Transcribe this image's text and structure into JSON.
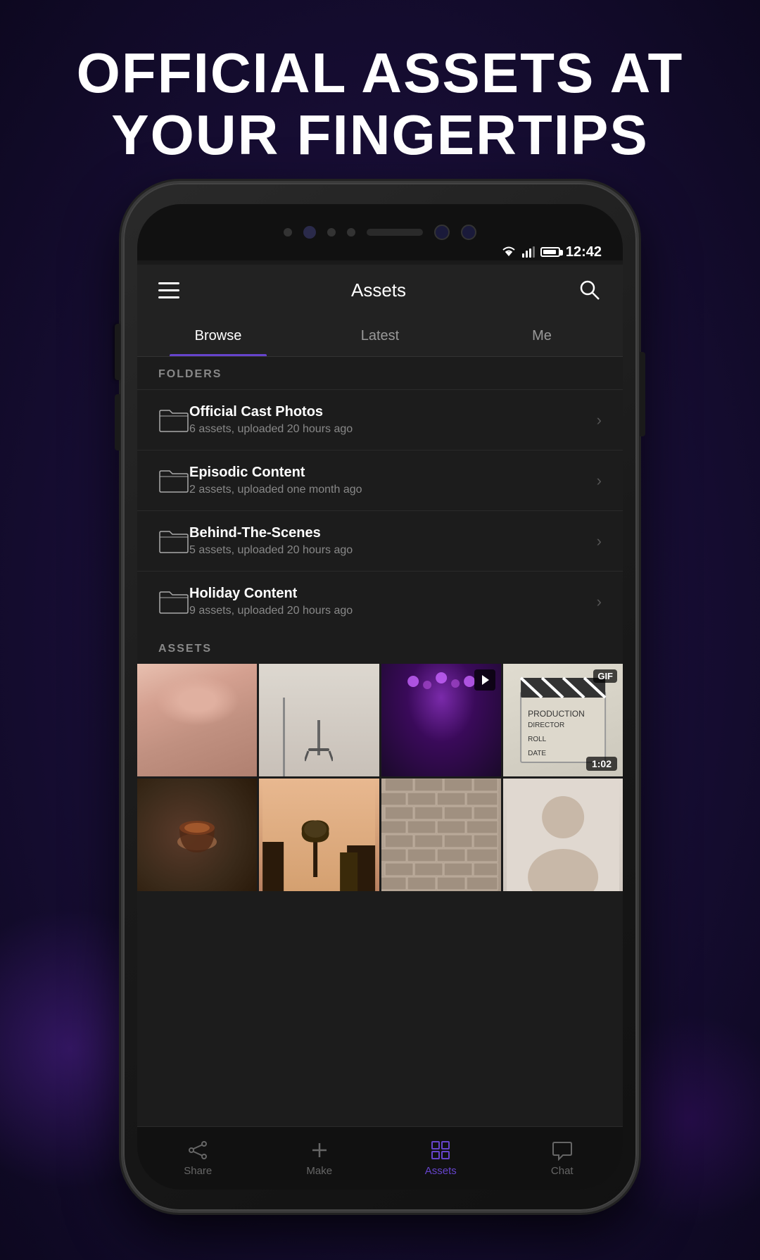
{
  "headline": {
    "line1": "OFFICIAL ASSETS AT",
    "line2": "YOUR FINGERTIPS"
  },
  "status_bar": {
    "time": "12:42"
  },
  "app_header": {
    "title": "Assets",
    "menu_label": "Menu",
    "search_label": "Search"
  },
  "tabs": [
    {
      "id": "browse",
      "label": "Browse",
      "active": true
    },
    {
      "id": "latest",
      "label": "Latest",
      "active": false
    },
    {
      "id": "me",
      "label": "Me",
      "active": false
    }
  ],
  "folders_section": {
    "title": "FOLDERS",
    "items": [
      {
        "name": "Official Cast Photos",
        "meta": "6 assets, uploaded 20 hours ago"
      },
      {
        "name": "Episodic Content",
        "meta": "2 assets, uploaded one month ago"
      },
      {
        "name": "Behind-The-Scenes",
        "meta": "5 assets, uploaded 20 hours ago"
      },
      {
        "name": "Holiday Content",
        "meta": "9 assets, uploaded 20 hours ago"
      }
    ]
  },
  "assets_section": {
    "title": "ASSETS"
  },
  "photos": [
    {
      "id": "photo-1",
      "type": "image",
      "class": "photo-face",
      "badge": null
    },
    {
      "id": "photo-2",
      "type": "image",
      "class": "photo-studio",
      "badge": null
    },
    {
      "id": "photo-3",
      "type": "video",
      "class": "photo-concert",
      "badge": "play"
    },
    {
      "id": "photo-4",
      "type": "gif",
      "class": "photo-clapboard",
      "badge": "gif",
      "duration": "1:02"
    },
    {
      "id": "photo-5",
      "type": "image",
      "class": "photo-coffee",
      "badge": null
    },
    {
      "id": "photo-6",
      "type": "image",
      "class": "photo-skyline",
      "badge": null
    },
    {
      "id": "photo-7",
      "type": "image",
      "class": "photo-wall",
      "badge": null
    },
    {
      "id": "photo-8",
      "type": "image",
      "class": "photo-portrait",
      "badge": null
    }
  ],
  "bottom_nav": [
    {
      "id": "share",
      "label": "Share",
      "active": false,
      "icon": "share-icon"
    },
    {
      "id": "make",
      "label": "Make",
      "active": false,
      "icon": "plus-icon"
    },
    {
      "id": "assets",
      "label": "Assets",
      "active": true,
      "icon": "grid-icon"
    },
    {
      "id": "chat",
      "label": "Chat",
      "active": false,
      "icon": "chat-icon"
    }
  ]
}
